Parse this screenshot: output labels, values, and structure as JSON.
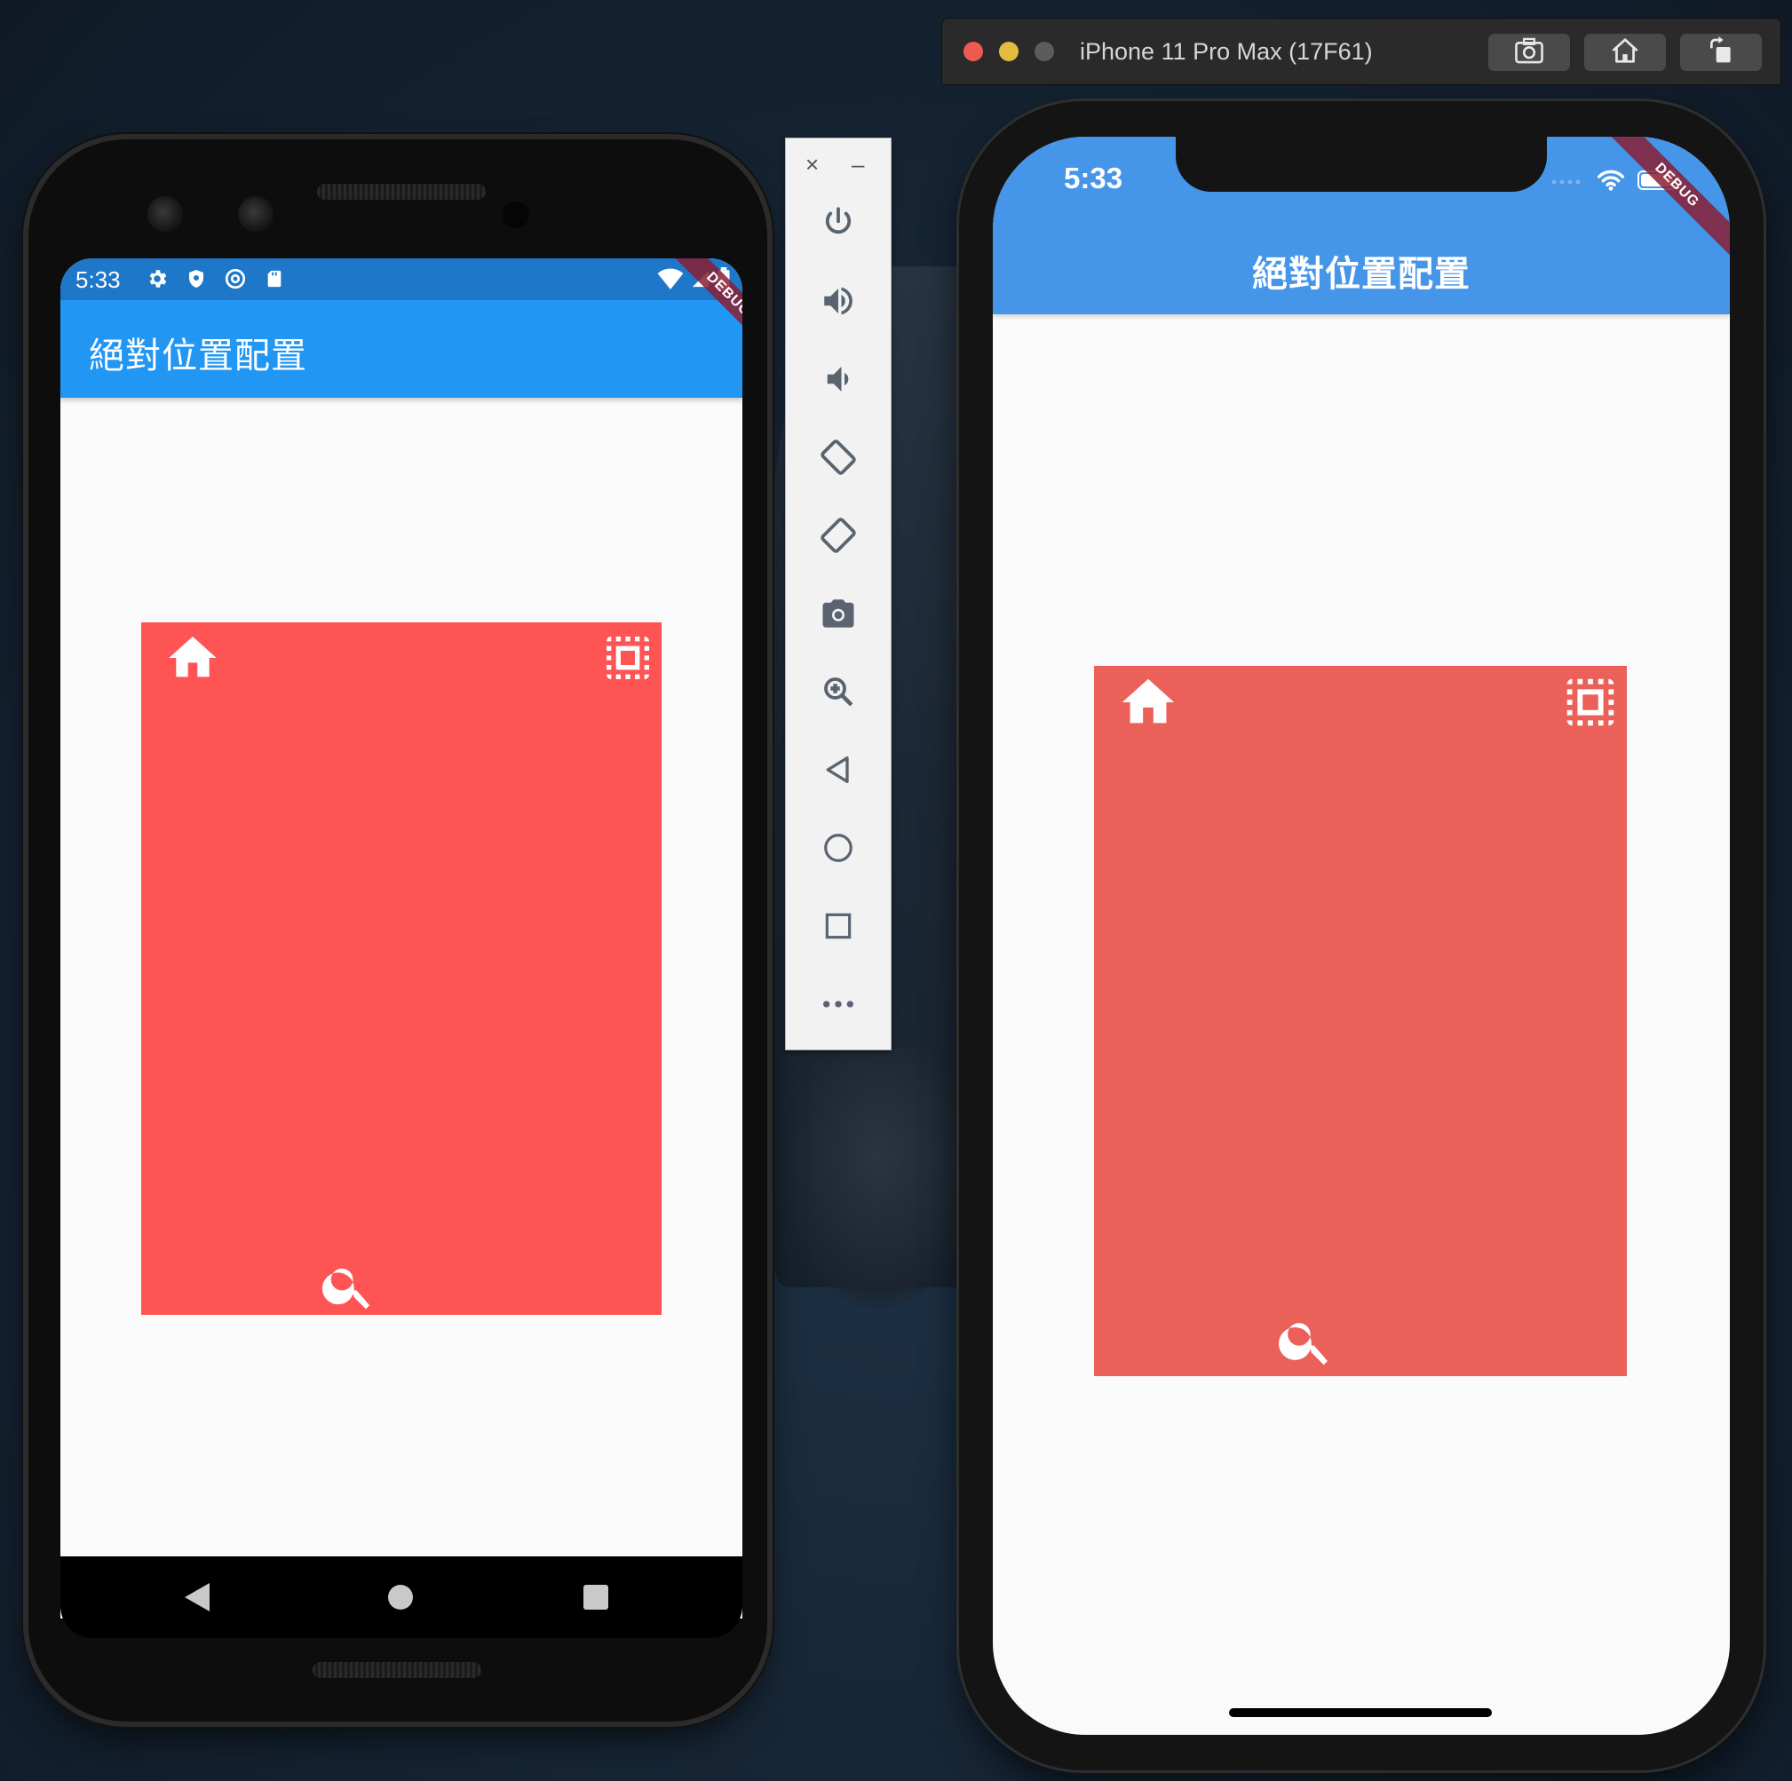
{
  "android": {
    "status_time": "5:33",
    "app_title": "絕對位置配置",
    "debug_banner": "DEBUG",
    "box_color": "#fe5454",
    "appbar_color": "#2196f3",
    "status_color": "#1e77c8",
    "icons": [
      "home-icon",
      "select-all-icon",
      "search-icon"
    ]
  },
  "emulator_toolbar": {
    "close_label": "×",
    "minimize_label": "–",
    "buttons": [
      "power-icon",
      "volume-up-icon",
      "volume-down-icon",
      "rotate-left-icon",
      "rotate-right-icon",
      "camera-icon",
      "zoom-icon",
      "back-icon",
      "home-icon",
      "overview-icon",
      "more-icon"
    ]
  },
  "ios": {
    "window_title": "iPhone 11 Pro Max (17F61)",
    "status_time": "5:33",
    "app_title": "絕對位置配置",
    "debug_banner": "DEBUG",
    "box_color": "#eb6059",
    "appbar_color": "#4595e9",
    "toolbar_buttons": [
      "screenshot-icon",
      "home-icon",
      "rotate-icon"
    ],
    "icons": [
      "home-icon",
      "select-all-icon",
      "search-icon"
    ]
  }
}
